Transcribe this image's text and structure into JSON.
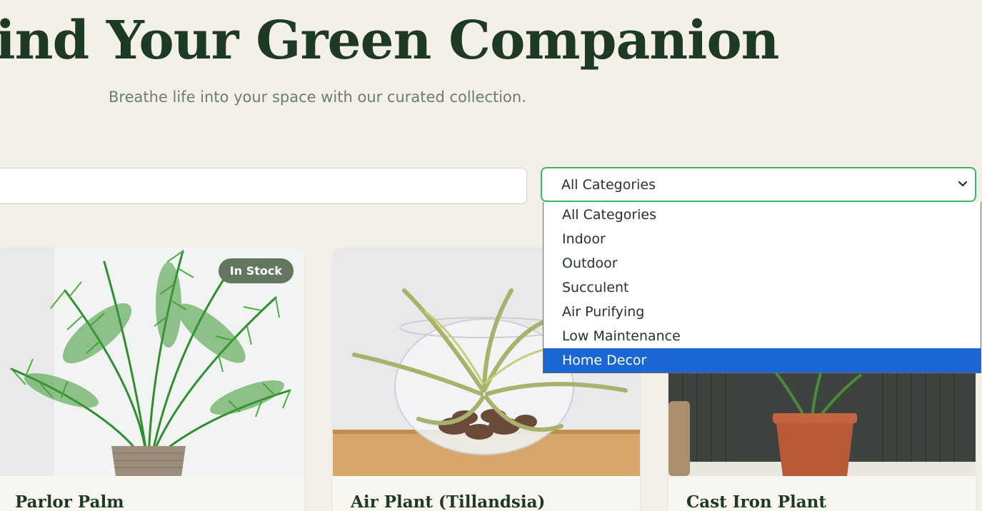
{
  "hero": {
    "title": "Find Your Green Companion",
    "subtitle": "Breathe life into your space with our curated collection."
  },
  "filters": {
    "search_value": "",
    "category_selected": "All Categories",
    "category_options": [
      "All Categories",
      "Indoor",
      "Outdoor",
      "Succulent",
      "Air Purifying",
      "Low Maintenance",
      "Home Decor"
    ],
    "highlighted_option": "Home Decor"
  },
  "products": [
    {
      "name": "Parlor Palm",
      "badge": "In Stock"
    },
    {
      "name": "Air Plant (Tillandsia)"
    },
    {
      "name": "Cast Iron Plant"
    }
  ],
  "colors": {
    "page_background": "#f3f0e8",
    "heading": "#1f3a24",
    "accent_green": "#3ab866",
    "badge_background": "#637760",
    "option_highlight": "#1a66d2"
  }
}
